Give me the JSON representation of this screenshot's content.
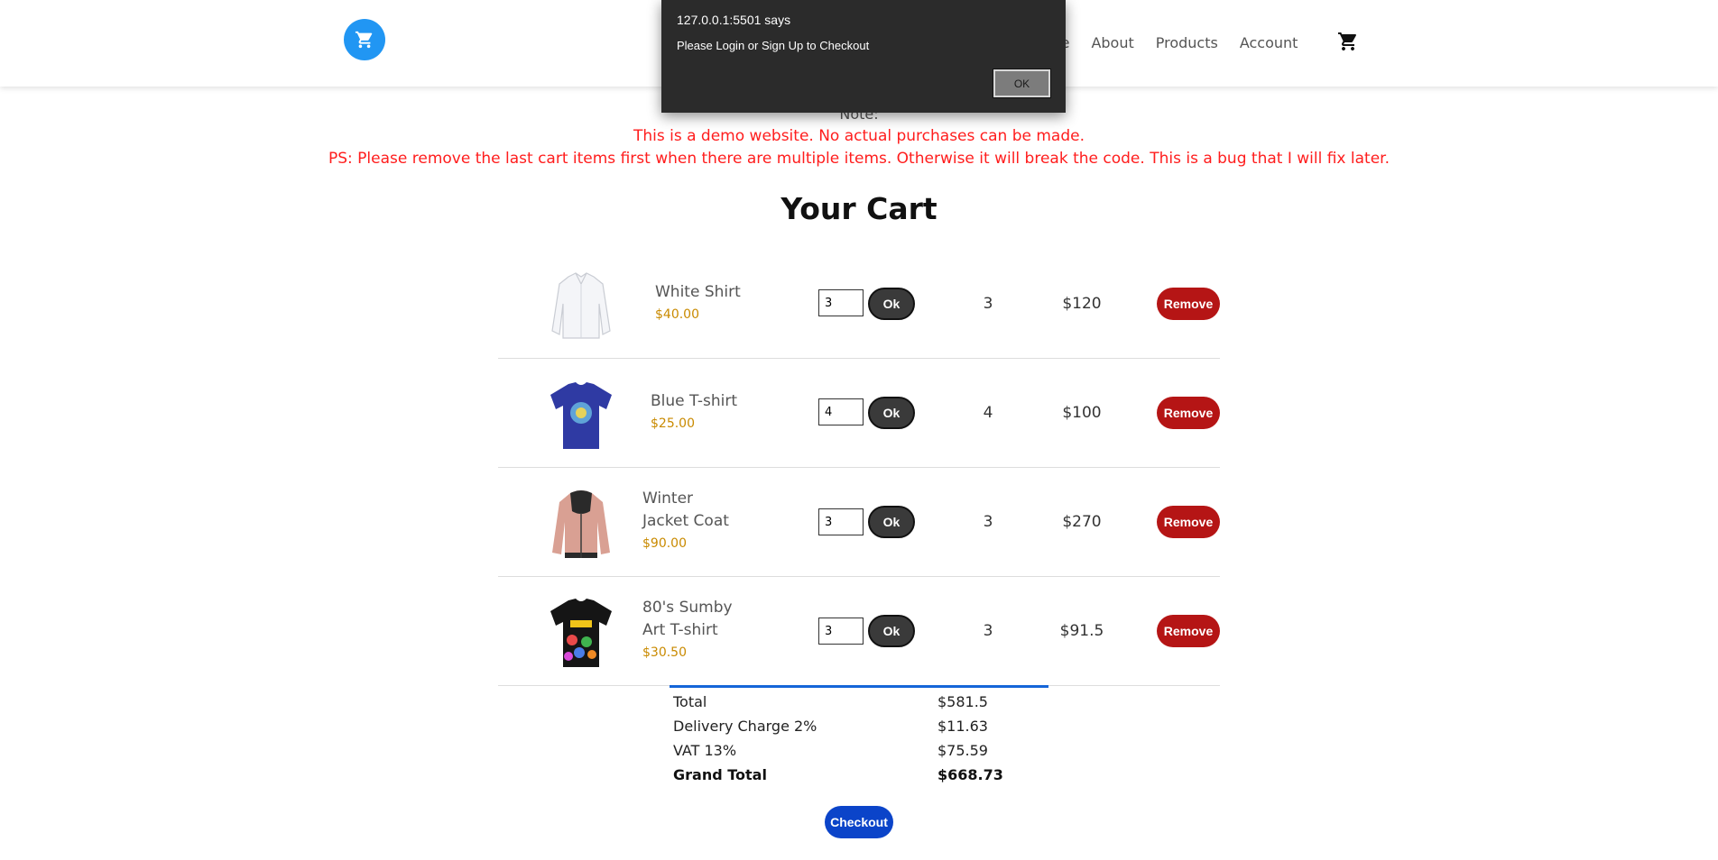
{
  "header": {
    "nav": [
      {
        "label": "me"
      },
      {
        "label": "About"
      },
      {
        "label": "Products"
      },
      {
        "label": "Account"
      }
    ],
    "cart_icon": "cart-icon",
    "logo_icon": "cart-icon"
  },
  "notes": {
    "heading": "Note:",
    "line1": "This is a demo website. No actual purchases can be made.",
    "line2": "PS: Please remove the last cart items first when there are multiple items. Otherwise it will break the code. This is a bug that I will fix later."
  },
  "cart": {
    "title": "Your Cart",
    "ok_label": "Ok",
    "remove_label": "Remove",
    "items": [
      {
        "name_line1": "White Shirt",
        "name_line2": "",
        "price": "$40.00",
        "qty_input": "3",
        "qty": "3",
        "subtotal": "$120",
        "image": "white-shirt"
      },
      {
        "name_line1": "Blue T-shirt",
        "name_line2": "",
        "price": "$25.00",
        "qty_input": "4",
        "qty": "4",
        "subtotal": "$100",
        "image": "blue-tshirt"
      },
      {
        "name_line1": "Winter",
        "name_line2": "Jacket Coat",
        "price": "$90.00",
        "qty_input": "3",
        "qty": "3",
        "subtotal": "$270",
        "image": "winter-jacket"
      },
      {
        "name_line1": "80's Sumby",
        "name_line2": "Art T-shirt",
        "price": "$30.50",
        "qty_input": "3",
        "qty": "3",
        "subtotal": "$91.5",
        "image": "art-tshirt"
      }
    ]
  },
  "totals": {
    "rows": [
      {
        "label": "Total",
        "value": "$581.5"
      },
      {
        "label": "Delivery Charge 2%",
        "value": "$11.63"
      },
      {
        "label": "VAT 13%",
        "value": "$75.59"
      },
      {
        "label": "Grand Total",
        "value": "$668.73"
      }
    ],
    "checkout_label": "Checkout"
  },
  "alert": {
    "title": "127.0.0.1:5501 says",
    "message": "Please Login or Sign Up to Checkout",
    "ok_label": "OK"
  },
  "colors": {
    "accent": "#2196f3",
    "note_red": "#ff1d1d",
    "price_gold": "#c98a00",
    "remove_red": "#b51515",
    "checkout_blue": "#0b44c9"
  }
}
